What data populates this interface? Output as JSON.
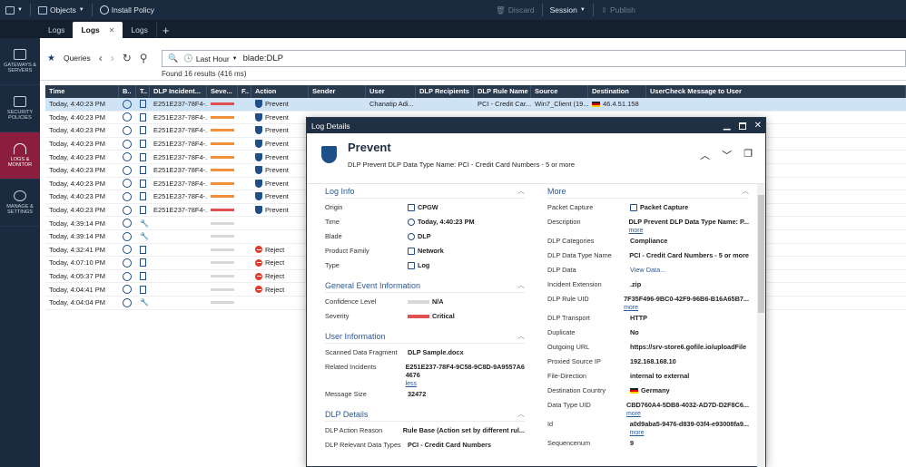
{
  "topbar": {
    "objects_label": "Objects",
    "install_label": "Install Policy",
    "discard_label": "Discard",
    "session_label": "Session",
    "publish_label": "Publish"
  },
  "tabs": [
    {
      "label": "Logs"
    },
    {
      "label": "Logs",
      "active": true
    },
    {
      "label": "Logs"
    }
  ],
  "nav": [
    {
      "label": "GATEWAYS & SERVERS"
    },
    {
      "label": "SECURITY POLICIES"
    },
    {
      "label": "LOGS & MONITOR",
      "active": true
    },
    {
      "label": "MANAGE & SETTINGS"
    }
  ],
  "toolbar": {
    "queries_label": "Queries",
    "time_filter": "Last Hour",
    "query": "blade:DLP",
    "found": "Found 16 results (416 ms)"
  },
  "columns": [
    "Time",
    "B..",
    "T..",
    "DLP Incident...",
    "Seve...",
    "F..",
    "Action",
    "Sender",
    "User",
    "DLP Recipients",
    "DLP Rule Name",
    "Source",
    "Destination",
    "UserCheck Message to User"
  ],
  "rows": [
    {
      "time": "Today, 4:40:23 PM",
      "inc": "E251E237-78F4-...",
      "sev": "crit",
      "action": "Prevent",
      "user": "Chanatip Adi...",
      "rule": "PCI - Credit Car...",
      "src": "Win7_Client (19...",
      "dst": "46.4.51.158",
      "sel": true
    },
    {
      "time": "Today, 4:40:23 PM",
      "inc": "E251E237-78F4-...",
      "sev": "high",
      "action": "Prevent",
      "user": "",
      "rule": "",
      "src": "",
      "dst": ""
    },
    {
      "time": "Today, 4:40:23 PM",
      "inc": "E251E237-78F4-...",
      "sev": "high",
      "action": "Prevent",
      "user": "",
      "rule": "",
      "src": "",
      "dst": ""
    },
    {
      "time": "Today, 4:40:23 PM",
      "inc": "E251E237-78F4-...",
      "sev": "high",
      "action": "Prevent",
      "user": "",
      "rule": "",
      "src": "",
      "dst": ""
    },
    {
      "time": "Today, 4:40:23 PM",
      "inc": "E251E237-78F4-...",
      "sev": "high",
      "action": "Prevent",
      "user": "",
      "rule": "",
      "src": "",
      "dst": ""
    },
    {
      "time": "Today, 4:40:23 PM",
      "inc": "E251E237-78F4-...",
      "sev": "high",
      "action": "Prevent",
      "user": "",
      "rule": "",
      "src": "",
      "dst": ""
    },
    {
      "time": "Today, 4:40:23 PM",
      "inc": "E251E237-78F4-...",
      "sev": "high",
      "action": "Prevent",
      "user": "",
      "rule": "",
      "src": "",
      "dst": ""
    },
    {
      "time": "Today, 4:40:23 PM",
      "inc": "E251E237-78F4-...",
      "sev": "high",
      "action": "Prevent",
      "user": "",
      "rule": "",
      "src": "",
      "dst": ""
    },
    {
      "time": "Today, 4:40:23 PM",
      "inc": "E251E237-78F4-...",
      "sev": "crit",
      "action": "Prevent",
      "user": "",
      "rule": "",
      "src": "",
      "dst": ""
    },
    {
      "time": "Today, 4:39:14 PM",
      "inc": "",
      "sev": "na",
      "action": "",
      "tool": true,
      "user": "",
      "rule": "",
      "src": "",
      "dst": ""
    },
    {
      "time": "Today, 4:39:14 PM",
      "inc": "",
      "sev": "na",
      "action": "",
      "tool": true,
      "user": "",
      "rule": "",
      "src": "",
      "dst": ""
    },
    {
      "time": "Today, 4:32:41 PM",
      "inc": "",
      "sev": "na",
      "action": "Reject",
      "user": "",
      "rule": "",
      "src": "",
      "dst": ""
    },
    {
      "time": "Today, 4:07:10 PM",
      "inc": "",
      "sev": "na",
      "action": "Reject",
      "user": "",
      "rule": "",
      "src": "",
      "dst": ""
    },
    {
      "time": "Today, 4:05:37 PM",
      "inc": "",
      "sev": "na",
      "action": "Reject",
      "user": "",
      "rule": "",
      "src": "",
      "dst": ""
    },
    {
      "time": "Today, 4:04:41 PM",
      "inc": "",
      "sev": "na",
      "action": "Reject",
      "user": "",
      "rule": "",
      "src": "",
      "dst": ""
    },
    {
      "time": "Today, 4:04:04 PM",
      "inc": "",
      "sev": "na",
      "action": "",
      "tool": true,
      "user": "",
      "rule": "",
      "src": "",
      "dst": ""
    }
  ],
  "modal": {
    "window_title": "Log Details",
    "heading": "Prevent",
    "subheading": "DLP Prevent DLP Data Type Name: PCI - Credit Card Numbers - 5 or more",
    "left": [
      {
        "title": "Log Info",
        "fields": [
          {
            "k": "Origin",
            "v": "CPGW",
            "icon": "gateway-icon"
          },
          {
            "k": "Time",
            "v": "Today, 4:40:23 PM",
            "icon": "clock-icon"
          },
          {
            "k": "Blade",
            "v": "DLP",
            "icon": "dlp-icon"
          },
          {
            "k": "Product Family",
            "v": "Network",
            "icon": "network-icon"
          },
          {
            "k": "Type",
            "v": "Log",
            "icon": "log-icon"
          }
        ]
      },
      {
        "title": "General Event Information",
        "fields": [
          {
            "k": "Confidence Level",
            "v": "N/A",
            "bar": "na"
          },
          {
            "k": "Severity",
            "v": "Critical",
            "bar": "crit"
          }
        ]
      },
      {
        "title": "User Information",
        "fields": [
          {
            "k": "Scanned Data Fragment",
            "v": "DLP Sample.docx"
          },
          {
            "k": "Related Incidents",
            "v": "E251E237-78F4-9C58-9C8D-9A9557A6",
            "v2": "4676",
            "more": "less"
          },
          {
            "k": "Message Size",
            "v": "32472"
          }
        ]
      },
      {
        "title": "DLP Details",
        "fields": [
          {
            "k": "DLP Action Reason",
            "v": "Rule Base (Action set by different rul..."
          },
          {
            "k": "DLP Relevant Data Types",
            "v": "PCI - Credit Card Numbers"
          }
        ]
      }
    ],
    "right": {
      "title": "More",
      "fields": [
        {
          "k": "Packet Capture",
          "v": "Packet Capture",
          "icon": "packet-capture-icon"
        },
        {
          "k": "Description",
          "v": "DLP Prevent DLP Data Type Name: P...",
          "more": "more"
        },
        {
          "k": "DLP Categories",
          "v": "Compliance"
        },
        {
          "k": "DLP Data Type Name",
          "v": "PCI - Credit Card Numbers - 5 or more"
        },
        {
          "k": "DLP Data",
          "v": "View Data...",
          "link": true
        },
        {
          "k": "Incident Extension",
          "v": ".zip"
        },
        {
          "k": "DLP Rule UID",
          "v": "7F35F496-9BC0-42F9-96B6-B16A65B7...",
          "more": "more"
        },
        {
          "k": "DLP Transport",
          "v": "HTTP"
        },
        {
          "k": "Duplicate",
          "v": "No"
        },
        {
          "k": "Outgoing URL",
          "v": "https://srv-store6.gofile.io/uploadFile"
        },
        {
          "k": "Proxied Source IP",
          "v": "192.168.168.10"
        },
        {
          "k": "File-Direction",
          "v": "internal to external"
        },
        {
          "k": "Destination Country",
          "v": "Germany",
          "flag": true
        },
        {
          "k": "Data Type UID",
          "v": "CBD760A4-5DB8-4032-AD7D-D2F8C6...",
          "more": "more"
        },
        {
          "k": "Id",
          "v": "a0d9aba5-9476-d839-03f4-e93008fa9...",
          "more": "more"
        },
        {
          "k": "Sequencenum",
          "v": "9"
        }
      ]
    }
  }
}
